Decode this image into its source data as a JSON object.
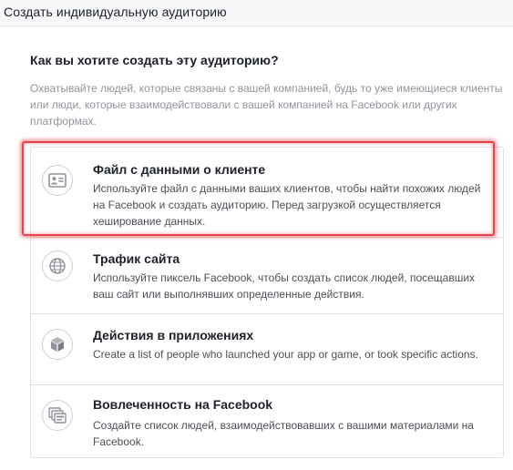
{
  "dialog": {
    "title": "Создать индивидуальную аудиторию"
  },
  "main": {
    "question": "Как вы хотите создать эту аудиторию?",
    "description": "Охватывайте людей, которые связаны с вашей компанией, будь то уже имеющиеся клиенты или люди, которые взаимодействовали с вашей компанией на Facebook или других платформах."
  },
  "options": [
    {
      "title": "Файл с данными о клиенте",
      "description": "Используйте файл с данными ваших клиентов, чтобы найти похожих людей на Facebook и создать аудиторию. Перед загрузкой осуществляется хеширование данных.",
      "icon": "contact-card-icon"
    },
    {
      "title": "Трафик сайта",
      "description": "Используйте пиксель Facebook, чтобы создать список людей, посещавших ваш сайт или выполнявших определенные действия.",
      "icon": "globe-icon"
    },
    {
      "title": "Действия в приложениях",
      "description": "Create a list of people who launched your app or game, or took specific actions.",
      "icon": "cube-icon"
    },
    {
      "title": "Вовлеченность на Facebook",
      "description": "Создайте список людей, взаимодействовавших с вашими материалами на Facebook.",
      "icon": "stacked-cards-icon"
    }
  ],
  "colors": {
    "highlight": "#e8434c",
    "title_text": "#1d2129",
    "muted_text": "#90949c",
    "border": "#dddfe2"
  }
}
